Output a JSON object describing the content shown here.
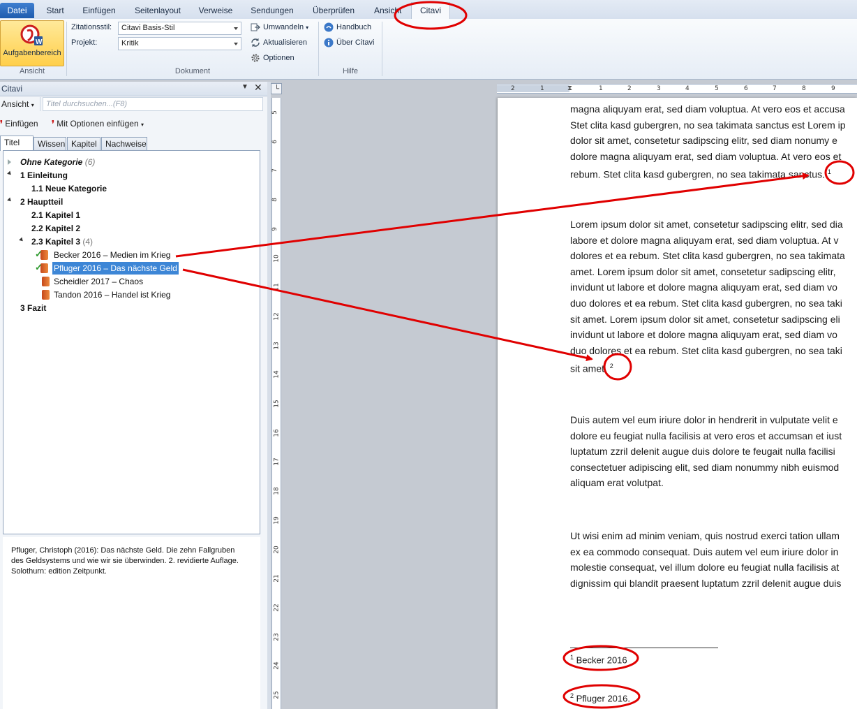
{
  "tabs": {
    "datei": "Datei",
    "start": "Start",
    "einfuegen": "Einfügen",
    "seitenlayout": "Seitenlayout",
    "verweise": "Verweise",
    "sendungen": "Sendungen",
    "ueberpruefen": "Überprüfen",
    "ansicht": "Ansicht",
    "citavi": "Citavi"
  },
  "ribbon": {
    "aufgabenbereich": "Aufgabenbereich",
    "group_ansicht": "Ansicht",
    "group_dokument": "Dokument",
    "group_hilfe": "Hilfe",
    "zitationsstil_label": "Zitationsstil:",
    "zitationsstil_value": "Citavi Basis-Stil",
    "projekt_label": "Projekt:",
    "projekt_value": "Kritik",
    "umwandeln": "Umwandeln",
    "aktualisieren": "Aktualisieren",
    "optionen": "Optionen",
    "handbuch": "Handbuch",
    "ueber": "Über Citavi"
  },
  "pane": {
    "title": "Citavi",
    "ansicht": "Ansicht",
    "search_placeholder": "Titel durchsuchen...(F8)",
    "einfuegen": "Einfügen",
    "mit_optionen": "Mit Optionen einfügen",
    "tabs": [
      "Titel",
      "Wissen",
      "Kapitel",
      "Nachweise"
    ],
    "tree": {
      "ohne_kategorie": "Ohne Kategorie",
      "ohne_count": "(6)",
      "einleitung": "1 Einleitung",
      "neue_kategorie": "1.1 Neue Kategorie",
      "hauptteil": "2 Hauptteil",
      "kapitel1": "2.1 Kapitel 1",
      "kapitel2": "2.2 Kapitel 2",
      "kapitel3": "2.3 Kapitel 3",
      "kapitel3_count": "(4)",
      "refs": [
        "Becker 2016 – Medien im Krieg",
        "Pfluger 2016 – Das nächste Geld",
        "Scheidler 2017 – Chaos",
        "Tandon 2016 – Handel ist Krieg"
      ],
      "fazit": "3 Fazit"
    },
    "detail": [
      "Pfluger, Christoph (2016): Das nächste Geld. Die zehn Fallgruben",
      "des Geldsystems und wie wir sie überwinden. 2. revidierte Auflage.",
      "Solothurn: edition Zeitpunkt."
    ]
  },
  "ruler": {
    "h": [
      "2",
      "1",
      "1",
      "2",
      "3",
      "4",
      "5",
      "6",
      "7",
      "8",
      "9"
    ],
    "v": [
      "5",
      "6",
      "7",
      "8",
      "9",
      "10",
      "11",
      "12",
      "13",
      "14",
      "15",
      "16",
      "17",
      "18",
      "19",
      "20",
      "21",
      "22",
      "23",
      "24",
      "25"
    ]
  },
  "document": {
    "p1": [
      "magna aliquyam erat, sed diam voluptua.  At vero eos et accusa",
      "Stet clita kasd gubergren, no sea takimata sanctus est Lorem ip",
      "dolor sit amet, consetetur  sadipscing elitr, sed diam nonumy e",
      "dolore magna aliquyam erat, sed diam voluptua.  At vero eos et",
      "rebum. Stet clita kasd gubergren, no sea takimata sanctus."
    ],
    "fn1": "1",
    "p2": [
      "Lorem ipsum dolor sit amet, consetetur  sadipscing elitr, sed dia",
      "labore et dolore magna aliquyam erat, sed diam voluptua.  At v",
      "dolores et ea rebum. Stet clita kasd gubergren, no sea takimata",
      "amet. Lorem ipsum dolor sit amet, consetetur  sadipscing elitr, ",
      "invidunt ut labore et dolore magna aliquyam erat, sed diam vo",
      "duo dolores et ea rebum. Stet clita kasd gubergren, no sea taki",
      "sit amet. Lorem ipsum dolor sit amet, consetetur  sadipscing eli",
      "invidunt ut labore et dolore magna aliquyam erat, sed diam vo",
      "duo dolores et ea rebum. Stet clita kasd gubergren, no sea taki",
      "sit amet."
    ],
    "fn2": "2",
    "p3": [
      "Duis autem vel eum iriure dolor in hendrerit in vulputate  velit e",
      "dolore eu feugiat nulla facilisis at vero eros et accumsan et iust",
      "luptatum zzril delenit augue duis dolore te feugait nulla facilisi",
      "consectetuer  adipiscing elit, sed diam nonummy nibh euismod",
      "aliquam erat volutpat."
    ],
    "p4": [
      "Ut wisi enim ad minim veniam, quis nostrud  exerci tation ullam",
      "ex ea commodo consequat.  Duis autem vel eum iriure dolor in",
      "molestie consequat,  vel illum dolore eu feugiat nulla facilisis at",
      "dignissim qui blandit praesent luptatum  zzril delenit augue duis"
    ],
    "footnote1": "Becker 2016",
    "footnote2": "Pfluger 2016."
  },
  "colors": {
    "annotation": "#e00000",
    "selection": "#3d86d6",
    "datei_tab": "#2a66b8"
  }
}
